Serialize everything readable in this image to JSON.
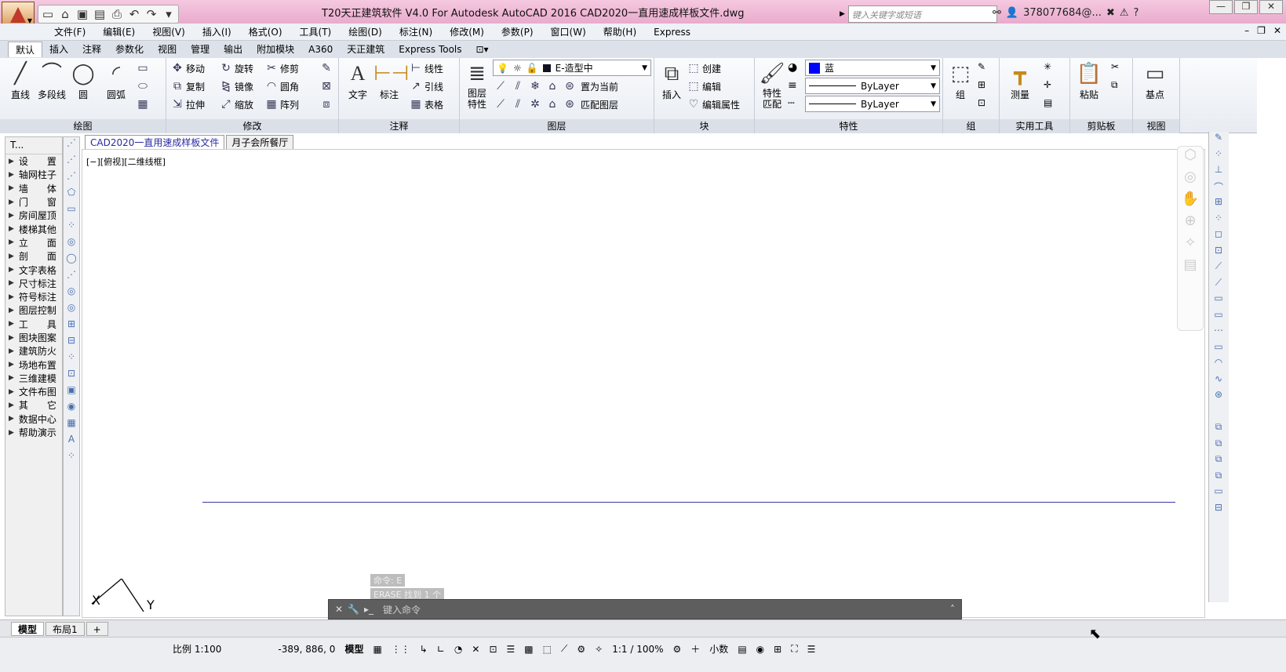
{
  "title": {
    "text": "T20天正建筑软件 V4.0 For Autodesk AutoCAD 2016      CAD2020一直用速成样板文件.dwg",
    "search_placeholder": "键入关键字或短语",
    "user": "378077684@...",
    "help": "?"
  },
  "menu": [
    "文件(F)",
    "编辑(E)",
    "视图(V)",
    "插入(I)",
    "格式(O)",
    "工具(T)",
    "绘图(D)",
    "标注(N)",
    "修改(M)",
    "参数(P)",
    "窗口(W)",
    "帮助(H)",
    "Express"
  ],
  "ribbon_tabs": [
    "默认",
    "插入",
    "注释",
    "参数化",
    "视图",
    "管理",
    "输出",
    "附加模块",
    "A360",
    "天正建筑",
    "Express Tools"
  ],
  "panels": {
    "draw": {
      "title": "绘图",
      "b1": "直线",
      "b2": "多段线",
      "b3": "圆",
      "b4": "圆弧"
    },
    "modify": {
      "title": "修改",
      "r1": [
        "移动",
        "旋转",
        "修剪"
      ],
      "r2": [
        "复制",
        "镜像",
        "圆角"
      ],
      "r3": [
        "拉伸",
        "缩放",
        "阵列"
      ]
    },
    "annot": {
      "title": "注释",
      "b1": "文字",
      "b2": "标注",
      "s1": "线性",
      "s2": "引线",
      "s3": "表格"
    },
    "layers": {
      "title": "图层",
      "b1": "图层",
      "b1b": "特性",
      "layer": "E-造型中",
      "s1": "置为当前",
      "s2": "匹配图层"
    },
    "block": {
      "title": "块",
      "b1": "插入",
      "s1": "创建",
      "s2": "编辑",
      "s3": "编辑属性"
    },
    "props": {
      "title": "特性",
      "b1": "特性",
      "b1b": "匹配",
      "color": "蓝",
      "color_hex": "#0000ff",
      "lt": "ByLayer",
      "lw": "ByLayer"
    },
    "group": {
      "title": "组",
      "b1": "组"
    },
    "util": {
      "title": "实用工具",
      "b1": "测量"
    },
    "clip": {
      "title": "剪贴板",
      "b1": "粘贴"
    },
    "view": {
      "title": "视图",
      "b1": "基点"
    }
  },
  "doc_tabs": [
    "CAD2020一直用速成样板文件",
    "月子会所餐厅"
  ],
  "palette": {
    "header": "T...",
    "items": [
      "设　　置",
      "轴网柱子",
      "墙　　体",
      "门　　窗",
      "房间屋顶",
      "楼梯其他",
      "立　　面",
      "剖　　面",
      "文字表格",
      "尺寸标注",
      "符号标注",
      "图层控制",
      "工　　具",
      "图块图案",
      "建筑防火",
      "场地布置",
      "三维建模",
      "文件布图",
      "其　　它",
      "数据中心",
      "帮助演示"
    ]
  },
  "viewport_label": "[−][俯视][二维线框]",
  "ucs": {
    "x": "X",
    "y": "Y"
  },
  "command": {
    "hist1": "命令: E",
    "hist2": "ERASE 找到 1 个",
    "prompt": "键入命令"
  },
  "layouts": [
    "模型",
    "布局1",
    "+"
  ],
  "status": {
    "scale": "比例 1:100",
    "coords": "-389, 886, 0",
    "model": "模型",
    "zoom": "1:1 / 100%",
    "units": "小数"
  }
}
